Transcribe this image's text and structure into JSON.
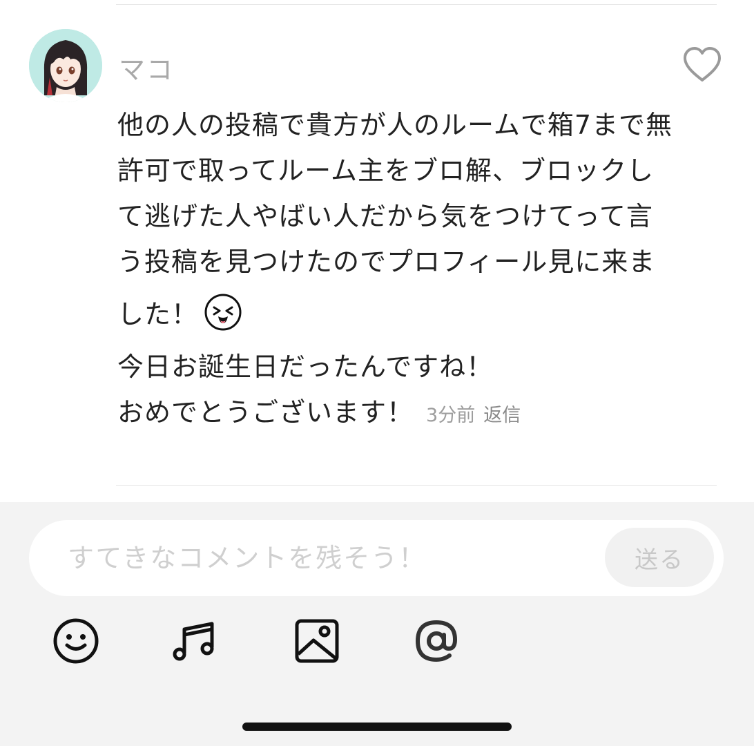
{
  "comment": {
    "username": "マコ",
    "body_lines": [
      "他の人の投稿で貴方が人のルームで箱7まで無",
      "許可で取ってルーム主をブロ解、ブロックし",
      "て逃げた人やばい人だから気をつけてって言",
      "う投稿を見つけたのでプロフィール見に来ま",
      "した！"
    ],
    "line2": "今日お誕生日だったんですね！",
    "line3": "おめでとうございます！",
    "time": "3分前",
    "reply_label": "返信",
    "emoji_icon": "laughing-face-icon",
    "like_icon": "heart-outline-icon",
    "avatar_icon": "anime-girl-avatar"
  },
  "composer": {
    "placeholder": "すてきなコメントを残そう！",
    "value": "",
    "send_label": "送る",
    "tools": [
      "smiley-icon",
      "music-note-icon",
      "image-icon",
      "at-sign-icon"
    ]
  },
  "colors": {
    "username": "#a9a9a9",
    "body_text": "#222222",
    "meta_text": "#9d9d9d",
    "composer_bg": "#f3f3f3",
    "send_text": "#c8c8c8",
    "avatar_bg": "#bfeae5"
  }
}
